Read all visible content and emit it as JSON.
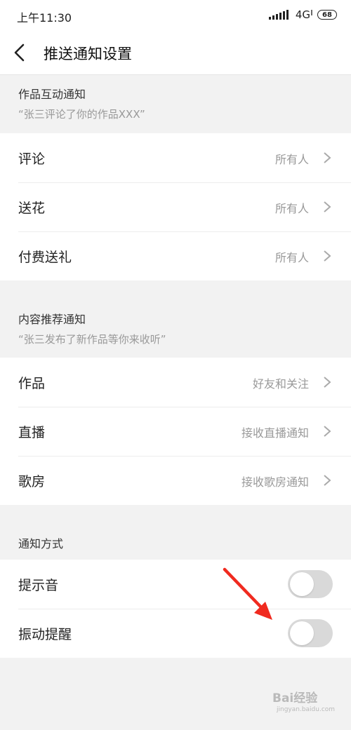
{
  "status_bar": {
    "time": "上午11:30",
    "network": "4G",
    "network_sup": "‖",
    "battery": "68"
  },
  "nav": {
    "title": "推送通知设置"
  },
  "sections": [
    {
      "title": "作品互动通知",
      "desc": "“张三评论了你的作品XXX”",
      "rows": [
        {
          "label": "评论",
          "value": "所有人"
        },
        {
          "label": "送花",
          "value": "所有人"
        },
        {
          "label": "付费送礼",
          "value": "所有人"
        }
      ]
    },
    {
      "title": "内容推荐通知",
      "desc": "“张三发布了新作品等你来收听”",
      "rows": [
        {
          "label": "作品",
          "value": "好友和关注"
        },
        {
          "label": "直播",
          "value": "接收直播通知"
        },
        {
          "label": "歌房",
          "value": "接收歌房通知"
        }
      ]
    },
    {
      "title": "通知方式",
      "toggles": [
        {
          "label": "提示音",
          "on": false
        },
        {
          "label": "振动提醒",
          "on": false
        }
      ]
    }
  ],
  "colors": {
    "annotation_arrow": "#f02a1f",
    "toggle_off": "#d9d9d9"
  },
  "watermark": {
    "text": "Bai经验",
    "sub": "jingyan.baidu.com"
  }
}
